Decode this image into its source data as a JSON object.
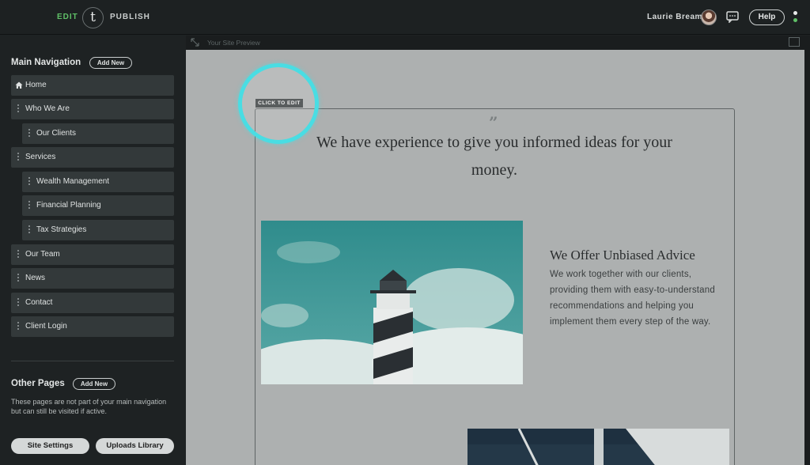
{
  "topbar": {
    "edit_label": "EDIT",
    "publish_label": "PUBLISH",
    "logo_letter": "t",
    "user_name": "Laurie Bream",
    "help_label": "Help",
    "active_color": "#5fc067"
  },
  "sidebar": {
    "main_nav_title": "Main Navigation",
    "add_new_label": "Add New",
    "items": [
      {
        "label": "Home",
        "icon": "home-icon"
      },
      {
        "label": "Who We Are"
      },
      {
        "label": "Our Clients"
      },
      {
        "label": "Services"
      },
      {
        "label": "Wealth Management"
      },
      {
        "label": "Financial Planning"
      },
      {
        "label": "Tax Strategies"
      },
      {
        "label": "Our Team"
      },
      {
        "label": "News"
      },
      {
        "label": "Contact"
      },
      {
        "label": "Client Login"
      }
    ],
    "other_pages_title": "Other Pages",
    "other_add_new_label": "Add New",
    "other_pages_desc": "These pages are not part of your main navigation but can still be visited if active.",
    "site_settings_label": "Site Settings",
    "uploads_library_label": "Uploads Library"
  },
  "preview": {
    "bar_label": "Your Site Preview",
    "click_to_edit": "CLICK TO EDIT",
    "quote_mark": "”",
    "quote_text": "We have experience to give you informed ideas for your money.",
    "advice_title": "We Offer Unbiased Advice",
    "advice_body": "We work together with our clients, providing them with easy-to-understand recommendations and helping you implement them every step of the way.",
    "highlight_color": "#49dde3"
  }
}
